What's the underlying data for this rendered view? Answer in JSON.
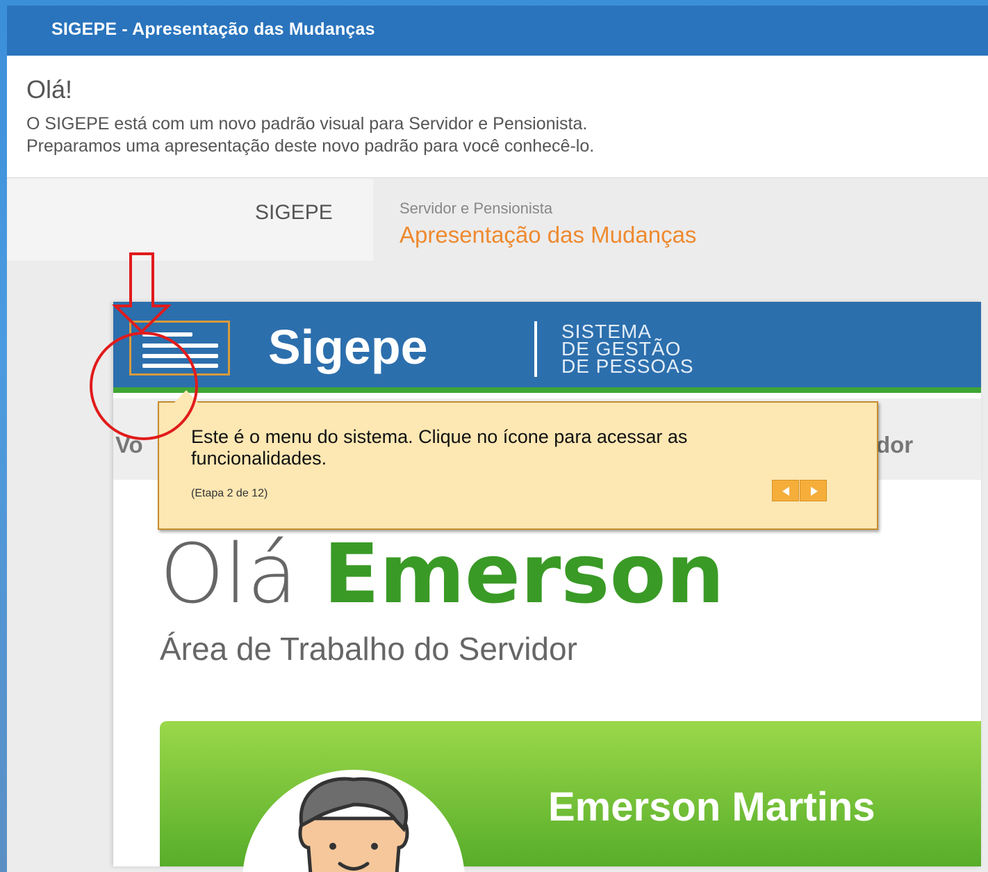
{
  "window": {
    "title": "SIGEPE - Apresentação das Mudanças"
  },
  "intro": {
    "greeting": "Olá!",
    "line1": "O SIGEPE está com um novo padrão visual para Servidor e Pensionista.",
    "line2": "Preparamos uma apresentação deste novo padrão para você conhecê-lo."
  },
  "crumbs": {
    "system": "SIGEPE",
    "subtitle": "Servidor e Pensionista",
    "title": "Apresentação das Mudanças"
  },
  "sigepe": {
    "logo": "Sigepe",
    "tagline": [
      "SISTEMA",
      "DE GESTÃO",
      "DE PESSOAS"
    ],
    "nav_left": "Vo",
    "nav_right": "dor",
    "hello_prefix": "Olá",
    "user_first_name": "Emerson",
    "area": "Área de Trabalho do Servidor",
    "user_full_name": "Emerson Martins"
  },
  "tooltip": {
    "message": "Este é o menu do sistema. Clique no ícone para acessar as funcionalidades.",
    "step": "(Etapa 2 de 12)",
    "prev_icon": "arrow-left-icon",
    "next_icon": "arrow-right-icon"
  },
  "colors": {
    "title_bar": "#2a74bd",
    "header": "#2c6fad",
    "accent_green": "#3a9a26",
    "accent_orange": "#ee8a30",
    "tooltip_bg": "#fde7b3",
    "annotation_red": "#e11b1b"
  }
}
